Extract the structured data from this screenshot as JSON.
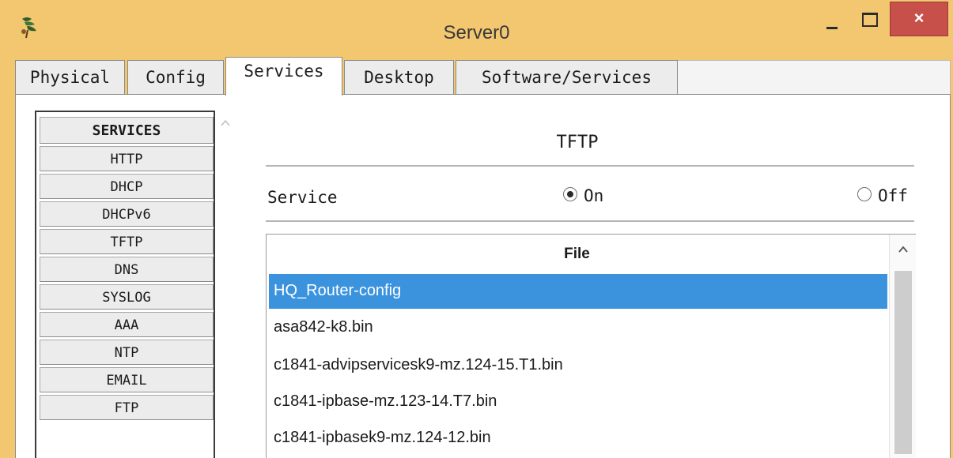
{
  "window": {
    "title": "Server0",
    "close_label": "×",
    "icon": "packet-tracer-app-icon"
  },
  "tabs": [
    {
      "label": "Physical",
      "active": false
    },
    {
      "label": "Config",
      "active": false
    },
    {
      "label": "Services",
      "active": true
    },
    {
      "label": "Desktop",
      "active": false
    },
    {
      "label": "Software/Services",
      "active": false
    }
  ],
  "services": {
    "header": "SERVICES",
    "items": [
      "HTTP",
      "DHCP",
      "DHCPv6",
      "TFTP",
      "DNS",
      "SYSLOG",
      "AAA",
      "NTP",
      "EMAIL",
      "FTP"
    ]
  },
  "tftp": {
    "title": "TFTP",
    "service_label": "Service",
    "on_label": "On",
    "off_label": "Off",
    "selected": "On"
  },
  "files": {
    "header": "File",
    "rows": [
      {
        "name": "HQ_Router-config",
        "selected": true
      },
      {
        "name": "asa842-k8.bin",
        "selected": false
      },
      {
        "name": "c1841-advipservicesk9-mz.124-15.T1.bin",
        "selected": false
      },
      {
        "name": "c1841-ipbase-mz.123-14.T7.bin",
        "selected": false
      },
      {
        "name": "c1841-ipbasek9-mz.124-12.bin",
        "selected": false
      }
    ]
  },
  "colors": {
    "title_bar": "#f2c76f",
    "close_button": "#c7504b",
    "selection": "#3b93de"
  }
}
